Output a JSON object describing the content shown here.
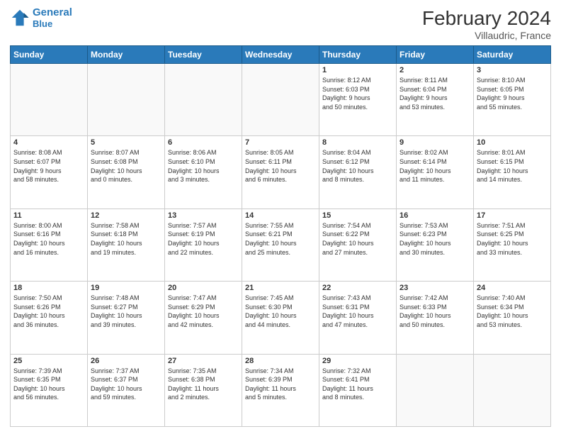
{
  "header": {
    "logo_line1": "General",
    "logo_line2": "Blue",
    "month_title": "February 2024",
    "location": "Villaudric, France"
  },
  "weekdays": [
    "Sunday",
    "Monday",
    "Tuesday",
    "Wednesday",
    "Thursday",
    "Friday",
    "Saturday"
  ],
  "weeks": [
    [
      {
        "day": "",
        "info": ""
      },
      {
        "day": "",
        "info": ""
      },
      {
        "day": "",
        "info": ""
      },
      {
        "day": "",
        "info": ""
      },
      {
        "day": "1",
        "info": "Sunrise: 8:12 AM\nSunset: 6:03 PM\nDaylight: 9 hours\nand 50 minutes."
      },
      {
        "day": "2",
        "info": "Sunrise: 8:11 AM\nSunset: 6:04 PM\nDaylight: 9 hours\nand 53 minutes."
      },
      {
        "day": "3",
        "info": "Sunrise: 8:10 AM\nSunset: 6:05 PM\nDaylight: 9 hours\nand 55 minutes."
      }
    ],
    [
      {
        "day": "4",
        "info": "Sunrise: 8:08 AM\nSunset: 6:07 PM\nDaylight: 9 hours\nand 58 minutes."
      },
      {
        "day": "5",
        "info": "Sunrise: 8:07 AM\nSunset: 6:08 PM\nDaylight: 10 hours\nand 0 minutes."
      },
      {
        "day": "6",
        "info": "Sunrise: 8:06 AM\nSunset: 6:10 PM\nDaylight: 10 hours\nand 3 minutes."
      },
      {
        "day": "7",
        "info": "Sunrise: 8:05 AM\nSunset: 6:11 PM\nDaylight: 10 hours\nand 6 minutes."
      },
      {
        "day": "8",
        "info": "Sunrise: 8:04 AM\nSunset: 6:12 PM\nDaylight: 10 hours\nand 8 minutes."
      },
      {
        "day": "9",
        "info": "Sunrise: 8:02 AM\nSunset: 6:14 PM\nDaylight: 10 hours\nand 11 minutes."
      },
      {
        "day": "10",
        "info": "Sunrise: 8:01 AM\nSunset: 6:15 PM\nDaylight: 10 hours\nand 14 minutes."
      }
    ],
    [
      {
        "day": "11",
        "info": "Sunrise: 8:00 AM\nSunset: 6:16 PM\nDaylight: 10 hours\nand 16 minutes."
      },
      {
        "day": "12",
        "info": "Sunrise: 7:58 AM\nSunset: 6:18 PM\nDaylight: 10 hours\nand 19 minutes."
      },
      {
        "day": "13",
        "info": "Sunrise: 7:57 AM\nSunset: 6:19 PM\nDaylight: 10 hours\nand 22 minutes."
      },
      {
        "day": "14",
        "info": "Sunrise: 7:55 AM\nSunset: 6:21 PM\nDaylight: 10 hours\nand 25 minutes."
      },
      {
        "day": "15",
        "info": "Sunrise: 7:54 AM\nSunset: 6:22 PM\nDaylight: 10 hours\nand 27 minutes."
      },
      {
        "day": "16",
        "info": "Sunrise: 7:53 AM\nSunset: 6:23 PM\nDaylight: 10 hours\nand 30 minutes."
      },
      {
        "day": "17",
        "info": "Sunrise: 7:51 AM\nSunset: 6:25 PM\nDaylight: 10 hours\nand 33 minutes."
      }
    ],
    [
      {
        "day": "18",
        "info": "Sunrise: 7:50 AM\nSunset: 6:26 PM\nDaylight: 10 hours\nand 36 minutes."
      },
      {
        "day": "19",
        "info": "Sunrise: 7:48 AM\nSunset: 6:27 PM\nDaylight: 10 hours\nand 39 minutes."
      },
      {
        "day": "20",
        "info": "Sunrise: 7:47 AM\nSunset: 6:29 PM\nDaylight: 10 hours\nand 42 minutes."
      },
      {
        "day": "21",
        "info": "Sunrise: 7:45 AM\nSunset: 6:30 PM\nDaylight: 10 hours\nand 44 minutes."
      },
      {
        "day": "22",
        "info": "Sunrise: 7:43 AM\nSunset: 6:31 PM\nDaylight: 10 hours\nand 47 minutes."
      },
      {
        "day": "23",
        "info": "Sunrise: 7:42 AM\nSunset: 6:33 PM\nDaylight: 10 hours\nand 50 minutes."
      },
      {
        "day": "24",
        "info": "Sunrise: 7:40 AM\nSunset: 6:34 PM\nDaylight: 10 hours\nand 53 minutes."
      }
    ],
    [
      {
        "day": "25",
        "info": "Sunrise: 7:39 AM\nSunset: 6:35 PM\nDaylight: 10 hours\nand 56 minutes."
      },
      {
        "day": "26",
        "info": "Sunrise: 7:37 AM\nSunset: 6:37 PM\nDaylight: 10 hours\nand 59 minutes."
      },
      {
        "day": "27",
        "info": "Sunrise: 7:35 AM\nSunset: 6:38 PM\nDaylight: 11 hours\nand 2 minutes."
      },
      {
        "day": "28",
        "info": "Sunrise: 7:34 AM\nSunset: 6:39 PM\nDaylight: 11 hours\nand 5 minutes."
      },
      {
        "day": "29",
        "info": "Sunrise: 7:32 AM\nSunset: 6:41 PM\nDaylight: 11 hours\nand 8 minutes."
      },
      {
        "day": "",
        "info": ""
      },
      {
        "day": "",
        "info": ""
      }
    ]
  ]
}
